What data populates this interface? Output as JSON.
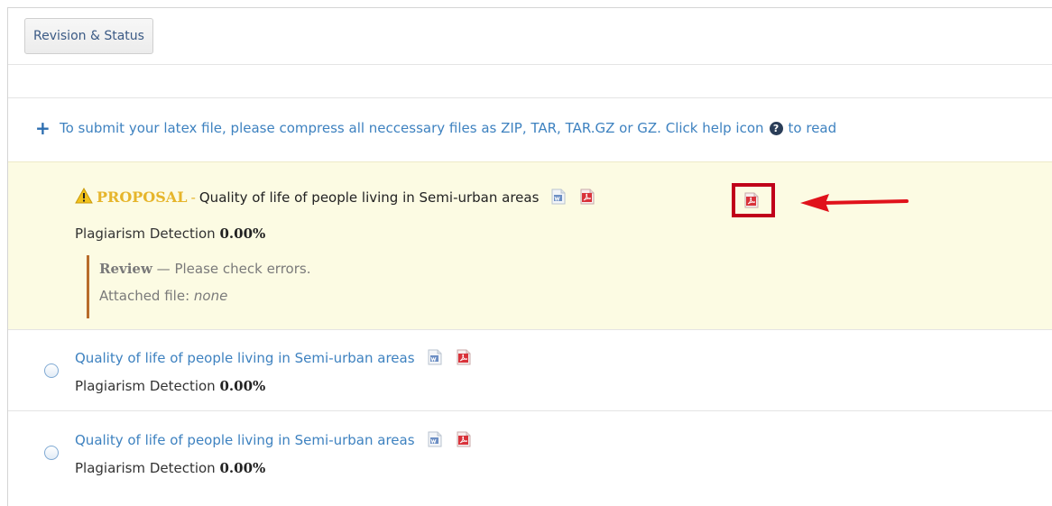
{
  "tabs": {
    "revision_status_label": "Revision & Status"
  },
  "notice": {
    "text": "To submit your latex file, please compress all neccessary files as ZIP, TAR, TAR.GZ or GZ. Click help icon",
    "help_icon_glyph": "?",
    "trailing": "to read"
  },
  "proposal": {
    "label": "PROPOSAL",
    "separator": "-",
    "title": "Quality of life of people living in Semi-urban areas",
    "plagiarism_label": "Plagiarism Detection",
    "plagiarism_value": "0.00%",
    "review": {
      "label": "Review",
      "message": "— Please check errors.",
      "attached_label": "Attached file:",
      "attached_value": "none"
    }
  },
  "items": [
    {
      "title": "Quality of life of people living in Semi-urban areas",
      "plagiarism_label": "Plagiarism Detection",
      "plagiarism_value": "0.00%"
    },
    {
      "title": "Quality of life of people living in Semi-urban areas",
      "plagiarism_label": "Plagiarism Detection",
      "plagiarism_value": "0.00%"
    }
  ],
  "icons": {
    "plus": "plus-icon",
    "warning": "warning-icon",
    "word": "word-document-icon",
    "pdf": "pdf-document-icon",
    "arrow": "red-arrow-annotation"
  },
  "colors": {
    "link": "#3e82c0",
    "proposal_label": "#e6b52b",
    "proposal_bg": "#fcfbe3",
    "highlight": "#c0001a",
    "review_bar": "#b86c2b"
  }
}
